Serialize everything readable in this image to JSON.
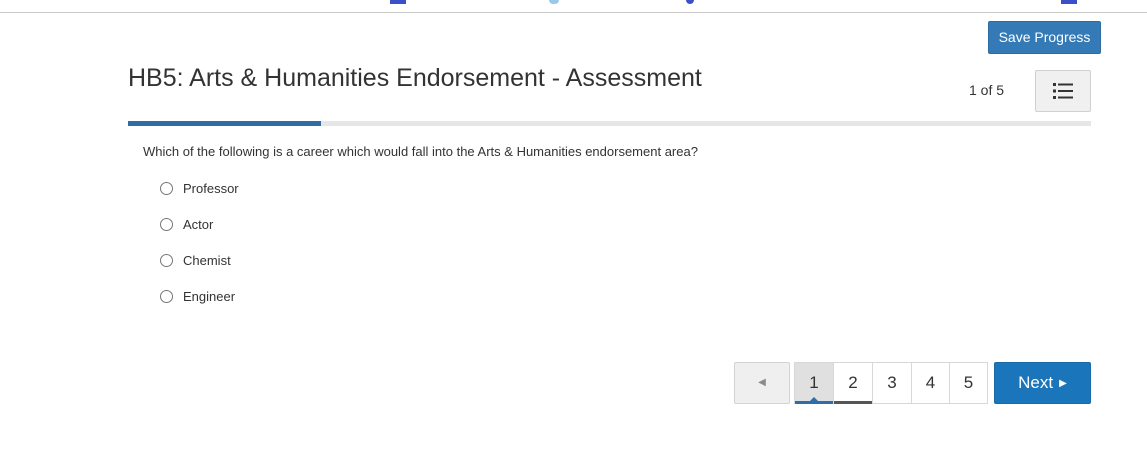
{
  "colors": {
    "primary": "#337ab7",
    "next_button": "#1b75bb",
    "progress": "#2d6ea8",
    "text": "#333333"
  },
  "header": {
    "save_label": "Save Progress",
    "title": "HB5: Arts & Humanities Endorsement - Assessment",
    "counter": "1 of 5",
    "list_icon": "list-icon"
  },
  "progress": {
    "current": 1,
    "total": 5,
    "fraction": 0.2
  },
  "question": {
    "text": "Which of the following is a career which would fall into the Arts & Humanities endorsement area?",
    "options": [
      {
        "label": "Professor",
        "selected": false
      },
      {
        "label": "Actor",
        "selected": false
      },
      {
        "label": "Chemist",
        "selected": false
      },
      {
        "label": "Engineer",
        "selected": false
      }
    ]
  },
  "pagination": {
    "prev_icon": "prev-arrow-icon",
    "pages": [
      "1",
      "2",
      "3",
      "4",
      "5"
    ],
    "active_page": "1",
    "next_label": "Next",
    "next_icon": "next-arrow-icon"
  }
}
